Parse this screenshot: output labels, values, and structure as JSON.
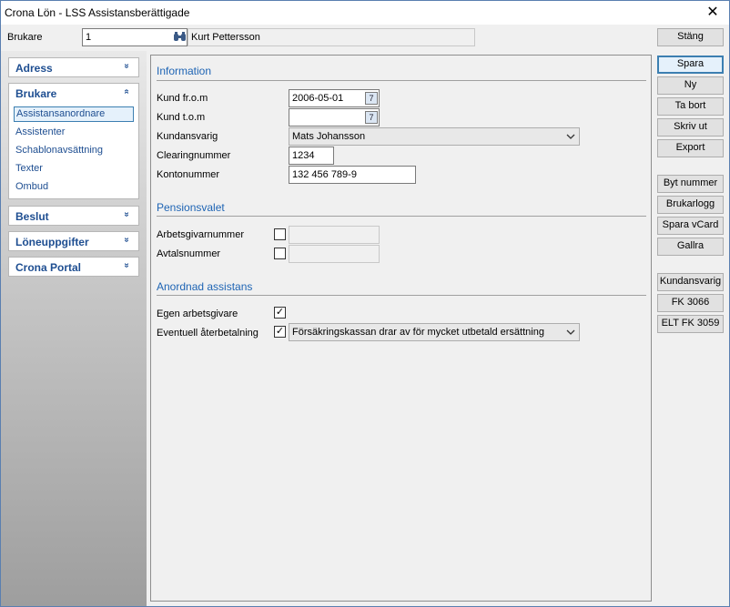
{
  "window": {
    "title": "Crona Lön - LSS Assistansberättigade",
    "close_glyph": "✕"
  },
  "toolbar": {
    "brukare_label": "Brukare",
    "brukare_number": "1",
    "brukare_name": "Kurt Pettersson",
    "stang_label": "Stäng"
  },
  "sidebar": {
    "sections": [
      {
        "label": "Adress",
        "chevron": "»"
      },
      {
        "label": "Brukare",
        "chevron": "«"
      },
      {
        "label": "Beslut",
        "chevron": "»"
      },
      {
        "label": "Löneuppgifter",
        "chevron": "»"
      },
      {
        "label": "Crona Portal",
        "chevron": "»"
      }
    ],
    "brukare_items": [
      "Assistansanordnare",
      "Assistenter",
      "Schablonavsättning",
      "Texter",
      "Ombud"
    ],
    "selected_item": "Assistansanordnare"
  },
  "information": {
    "heading": "Information",
    "kund_from_label": "Kund fr.o.m",
    "kund_from_value": "2006-05-01",
    "kund_tom_label": "Kund t.o.m",
    "kund_tom_value": "",
    "kundansvarig_label": "Kundansvarig",
    "kundansvarig_value": "Mats Johansson",
    "clearing_label": "Clearingnummer",
    "clearing_value": "1234",
    "konto_label": "Kontonummer",
    "konto_value": "132 456 789-9",
    "cal_glyph": "7"
  },
  "pension": {
    "heading": "Pensionsvalet",
    "arbetsgivar_label": "Arbetsgivarnummer",
    "arbetsgivar_checked": false,
    "avtal_label": "Avtalsnummer",
    "avtal_checked": false
  },
  "anordnad": {
    "heading": "Anordnad assistans",
    "egen_label": "Egen arbetsgivare",
    "egen_checked": true,
    "check_glyph": "✓",
    "aterbetalning_label": "Eventuell återbetalning",
    "aterbetalning_checked": true,
    "aterbetalning_value": "Försäkringskassan drar av för mycket utbetald ersättning"
  },
  "actions": {
    "group1": [
      "Spara",
      "Ny",
      "Ta bort",
      "Skriv ut",
      "Export"
    ],
    "group2": [
      "Byt nummer",
      "Brukarlogg",
      "Spara vCard",
      "Gallra"
    ],
    "group3": [
      "Kundansvarig",
      "FK 3066",
      "ELT FK 3059"
    ]
  },
  "icons": {
    "search": "binoculars-icon",
    "dropdown": "chevron-down-icon",
    "calendar": "calendar-icon"
  },
  "colors": {
    "accent": "#1e4e91",
    "section": "#1e64b4",
    "selection_border": "#3c7fb1"
  }
}
